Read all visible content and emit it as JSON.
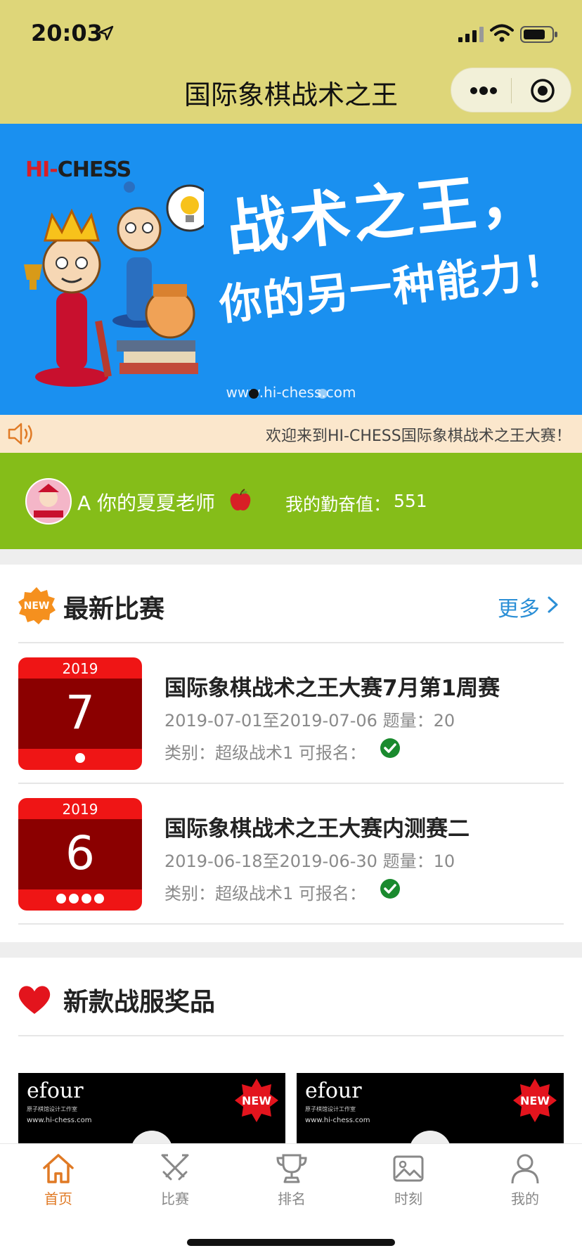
{
  "status_bar": {
    "time": "20:03"
  },
  "nav": {
    "title": "国际象棋战术之王"
  },
  "banner": {
    "logo_hi": "HI-",
    "logo_chess": "CHESS",
    "headline": "战术之王，",
    "subline": "你的另一种能力！",
    "url": "www.hi-chess.com"
  },
  "notice": {
    "text": "欢迎来到HI-CHESS国际象棋战术之王大赛！"
  },
  "user": {
    "name": "A 你的夏夏老师",
    "diligence_label": "我的勤奋值：",
    "diligence_value": "551"
  },
  "matches_section": {
    "title": "最新比赛",
    "more_label": "更多",
    "badge": "NEW"
  },
  "matches": [
    {
      "year": "2019",
      "month": "7",
      "dots": 1,
      "title": "国际象棋战术之王大赛7月第1周赛",
      "meta": "2019-07-01至2019-07-06  题量：20",
      "category": "类别：超级战术1  可报名："
    },
    {
      "year": "2019",
      "month": "6",
      "dots": 4,
      "title": "国际象棋战术之王大赛内测赛二",
      "meta": "2019-06-18至2019-06-30  题量：10",
      "category": "类别：超级战术1  可报名："
    }
  ],
  "prizes_section": {
    "title": "新款战服奖品"
  },
  "prizes": [
    {
      "brand": "efour",
      "sub": "原子棋馆设计工作室",
      "url": "www.hi-chess.com",
      "badge": "NEW"
    },
    {
      "brand": "efour",
      "sub": "原子棋馆设计工作室",
      "url": "www.hi-chess.com",
      "badge": "NEW"
    }
  ],
  "tabs": [
    {
      "label": "首页",
      "icon": "home-icon",
      "active": true
    },
    {
      "label": "比赛",
      "icon": "swords-icon",
      "active": false
    },
    {
      "label": "排名",
      "icon": "trophy-icon",
      "active": false
    },
    {
      "label": "时刻",
      "icon": "picture-icon",
      "active": false
    },
    {
      "label": "我的",
      "icon": "user-icon",
      "active": false
    }
  ],
  "colors": {
    "header": "#ded679",
    "banner": "#1a90f0",
    "user_bar": "#85bd19",
    "accent": "#e07a25",
    "link": "#2b8fd6",
    "calendar_red": "#ef1515"
  }
}
